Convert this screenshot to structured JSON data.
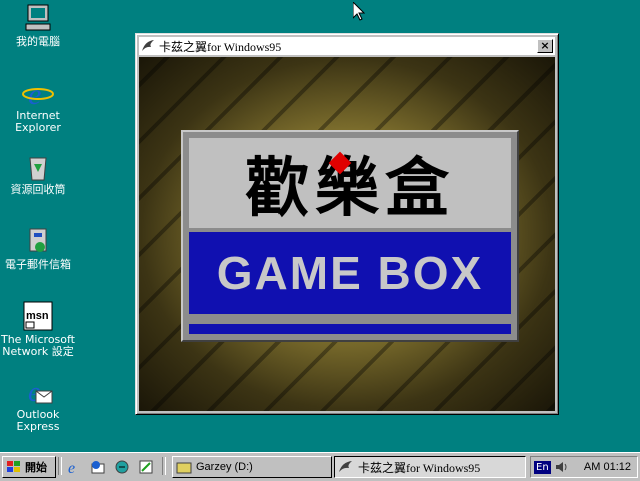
{
  "desktop": {
    "icons": [
      {
        "label": "我的電腦"
      },
      {
        "label": "Internet Explorer"
      },
      {
        "label": "資源回收筒"
      },
      {
        "label": "電子郵件信箱"
      },
      {
        "label": "The Microsoft Network 設定"
      },
      {
        "label": "Outlook Express"
      }
    ]
  },
  "window": {
    "title": "卡茲之翼for Windows95",
    "close_label": "×",
    "logo_cn": "歡樂盒",
    "logo_en": "GAME BOX"
  },
  "taskbar": {
    "start_label": "開始",
    "tasks": [
      {
        "label": "Garzey (D:)"
      },
      {
        "label": "卡茲之翼for Windows95"
      }
    ],
    "tray": {
      "lang": "En",
      "clock": "AM 01:12"
    }
  },
  "colors": {
    "desktop": "#008080",
    "logo_blue": "#1010b0",
    "accent_red": "#e00000"
  }
}
